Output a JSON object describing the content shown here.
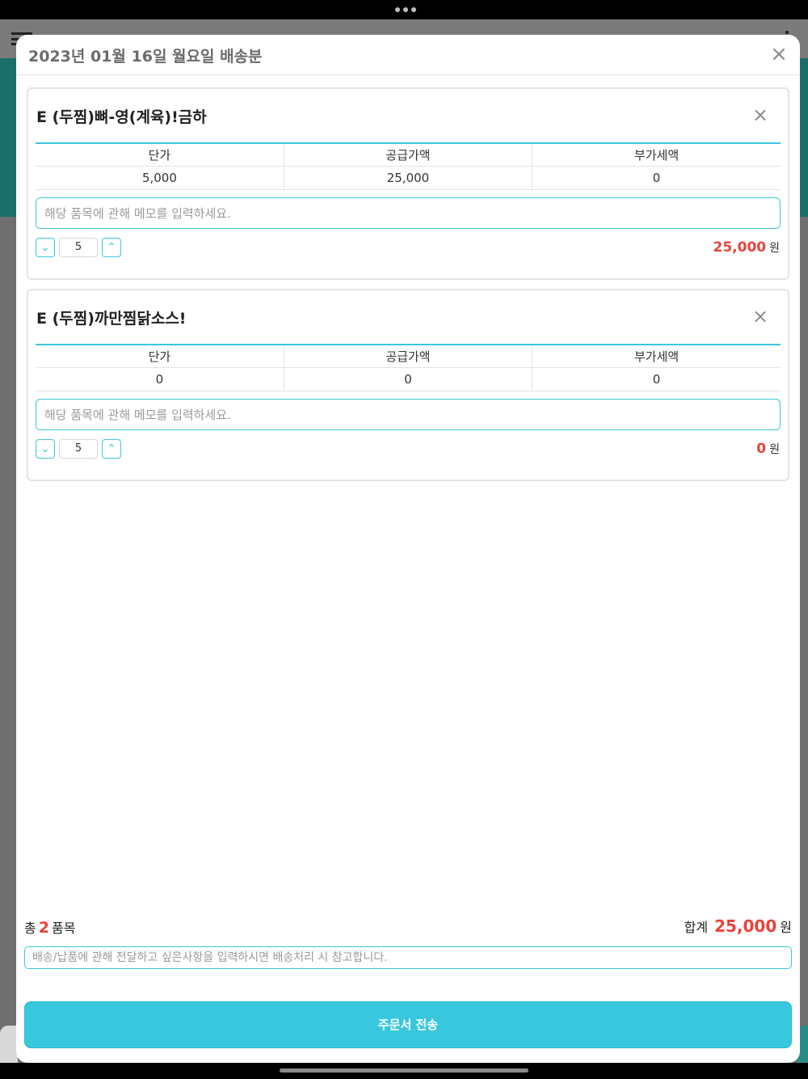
{
  "modal": {
    "title": "2023년 01월 16일 월요일 배송분",
    "close_icon": "×"
  },
  "table_headers": [
    "단가",
    "공급가액",
    "부가세액"
  ],
  "items": [
    {
      "name": "E (두찜)뼈-영(계육)!금하",
      "unit_price": "5,000",
      "supply_amount": "25,000",
      "vat_amount": "0",
      "memo_placeholder": "해당 품목에 관해 메모를 입력하세요.",
      "quantity": "5",
      "total_amount": "25,000",
      "currency": "원"
    },
    {
      "name": "E (두찜)까만찜닭소스!",
      "unit_price": "0",
      "supply_amount": "0",
      "vat_amount": "0",
      "memo_placeholder": "해당 품목에 관해 메모를 입력하세요.",
      "quantity": "5",
      "total_amount": "0",
      "currency": "원"
    }
  ],
  "summary": {
    "total_prefix": "총",
    "item_count": "2",
    "item_suffix": "품목",
    "sum_label": "합계",
    "sum_amount": "25,000",
    "currency": "원"
  },
  "delivery_note_placeholder": "배송/납품에 관해 전달하고 싶은사항을 입력하시면 배송처리 시 참고합니다.",
  "submit_label": "주문서 전송",
  "colors": {
    "accent": "#38c8de",
    "price_red": "#e8433a"
  },
  "icons": {
    "remove": "close-icon",
    "decrease": "chevron-down-icon",
    "increase": "chevron-up-icon"
  }
}
